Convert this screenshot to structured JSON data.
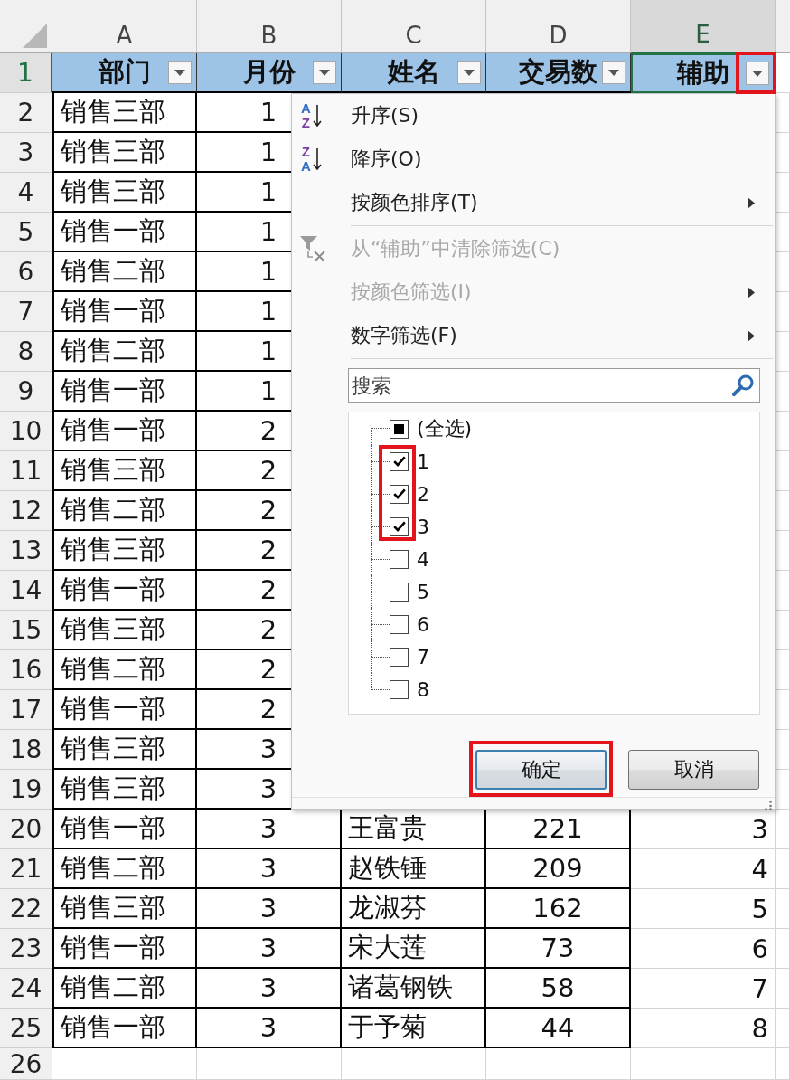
{
  "columns": [
    {
      "letter": "A",
      "selected": false
    },
    {
      "letter": "B",
      "selected": false
    },
    {
      "letter": "C",
      "selected": false
    },
    {
      "letter": "D",
      "selected": false
    },
    {
      "letter": "E",
      "selected": true
    }
  ],
  "header_row": {
    "number": "1",
    "selected": true,
    "cells": [
      {
        "text": "部门",
        "active": false,
        "filter_highlighted": false
      },
      {
        "text": "月份",
        "active": false,
        "filter_highlighted": false
      },
      {
        "text": "姓名",
        "active": false,
        "filter_highlighted": false
      },
      {
        "text": "交易数",
        "active": false,
        "filter_highlighted": false
      },
      {
        "text": "辅助",
        "active": true,
        "filter_highlighted": true
      }
    ]
  },
  "rows": [
    {
      "number": "2",
      "selected": false,
      "cells": [
        "销售三部",
        "1"
      ]
    },
    {
      "number": "3",
      "selected": false,
      "cells": [
        "销售三部",
        "1"
      ]
    },
    {
      "number": "4",
      "selected": false,
      "cells": [
        "销售三部",
        "1"
      ]
    },
    {
      "number": "5",
      "selected": false,
      "cells": [
        "销售一部",
        "1"
      ]
    },
    {
      "number": "6",
      "selected": false,
      "cells": [
        "销售二部",
        "1"
      ]
    },
    {
      "number": "7",
      "selected": false,
      "cells": [
        "销售一部",
        "1"
      ]
    },
    {
      "number": "8",
      "selected": false,
      "cells": [
        "销售二部",
        "1"
      ]
    },
    {
      "number": "9",
      "selected": false,
      "cells": [
        "销售一部",
        "1"
      ]
    },
    {
      "number": "10",
      "selected": false,
      "cells": [
        "销售一部",
        "2"
      ]
    },
    {
      "number": "11",
      "selected": false,
      "cells": [
        "销售三部",
        "2"
      ]
    },
    {
      "number": "12",
      "selected": false,
      "cells": [
        "销售二部",
        "2"
      ]
    },
    {
      "number": "13",
      "selected": false,
      "cells": [
        "销售三部",
        "2"
      ]
    },
    {
      "number": "14",
      "selected": false,
      "cells": [
        "销售一部",
        "2"
      ]
    },
    {
      "number": "15",
      "selected": false,
      "cells": [
        "销售三部",
        "2"
      ]
    },
    {
      "number": "16",
      "selected": false,
      "cells": [
        "销售二部",
        "2"
      ]
    },
    {
      "number": "17",
      "selected": false,
      "cells": [
        "销售一部",
        "2"
      ]
    },
    {
      "number": "18",
      "selected": false,
      "cells": [
        "销售三部",
        "3"
      ]
    },
    {
      "number": "19",
      "selected": false,
      "cells": [
        "销售三部",
        "3"
      ]
    },
    {
      "number": "20",
      "selected": false,
      "cells": [
        "销售一部",
        "3",
        "王富贵",
        "221",
        "3"
      ]
    },
    {
      "number": "21",
      "selected": false,
      "cells": [
        "销售二部",
        "3",
        "赵铁锤",
        "209",
        "4"
      ]
    },
    {
      "number": "22",
      "selected": false,
      "cells": [
        "销售三部",
        "3",
        "龙淑芬",
        "162",
        "5"
      ]
    },
    {
      "number": "23",
      "selected": false,
      "cells": [
        "销售一部",
        "3",
        "宋大莲",
        "73",
        "6"
      ]
    },
    {
      "number": "24",
      "selected": false,
      "cells": [
        "销售二部",
        "3",
        "诸葛钢铁",
        "58",
        "7"
      ]
    },
    {
      "number": "25",
      "selected": false,
      "cells": [
        "销售一部",
        "3",
        "于予菊",
        "44",
        "8"
      ]
    },
    {
      "number": "26",
      "selected": false
    }
  ],
  "filter_menu": {
    "sort_items": [
      {
        "kind": "ascending",
        "icon_letters": [
          "A",
          "Z"
        ],
        "label": "升序(S)",
        "disabled": false,
        "submenu": false
      },
      {
        "kind": "descending",
        "icon_letters": [
          "Z",
          "A"
        ],
        "label": "降序(O)",
        "disabled": false,
        "submenu": false
      },
      {
        "kind": "plain",
        "label": "按颜色排序(T)",
        "disabled": false,
        "submenu": true
      }
    ],
    "filter_items": [
      {
        "kind": "clear",
        "label": "从“辅助”中清除筛选(C)",
        "disabled": true,
        "submenu": false
      },
      {
        "kind": "plain",
        "label": "按颜色筛选(I)",
        "disabled": true,
        "submenu": true
      },
      {
        "kind": "plain",
        "label": "数字筛选(F)",
        "disabled": false,
        "submenu": true
      }
    ],
    "search": {
      "placeholder": "搜索"
    },
    "select_all": {
      "label": "(全选)",
      "mixed": true
    },
    "values": [
      {
        "label": "1",
        "checked": true
      },
      {
        "label": "2",
        "checked": true
      },
      {
        "label": "3",
        "checked": true
      },
      {
        "label": "4",
        "checked": false
      },
      {
        "label": "5",
        "checked": false
      },
      {
        "label": "6",
        "checked": false
      },
      {
        "label": "7",
        "checked": false
      },
      {
        "label": "8",
        "checked": false
      }
    ],
    "checked_highlighted": true,
    "buttons": [
      {
        "label": "确定",
        "default": true,
        "highlighted": true
      },
      {
        "label": "取消",
        "default": false,
        "highlighted": false
      }
    ]
  }
}
